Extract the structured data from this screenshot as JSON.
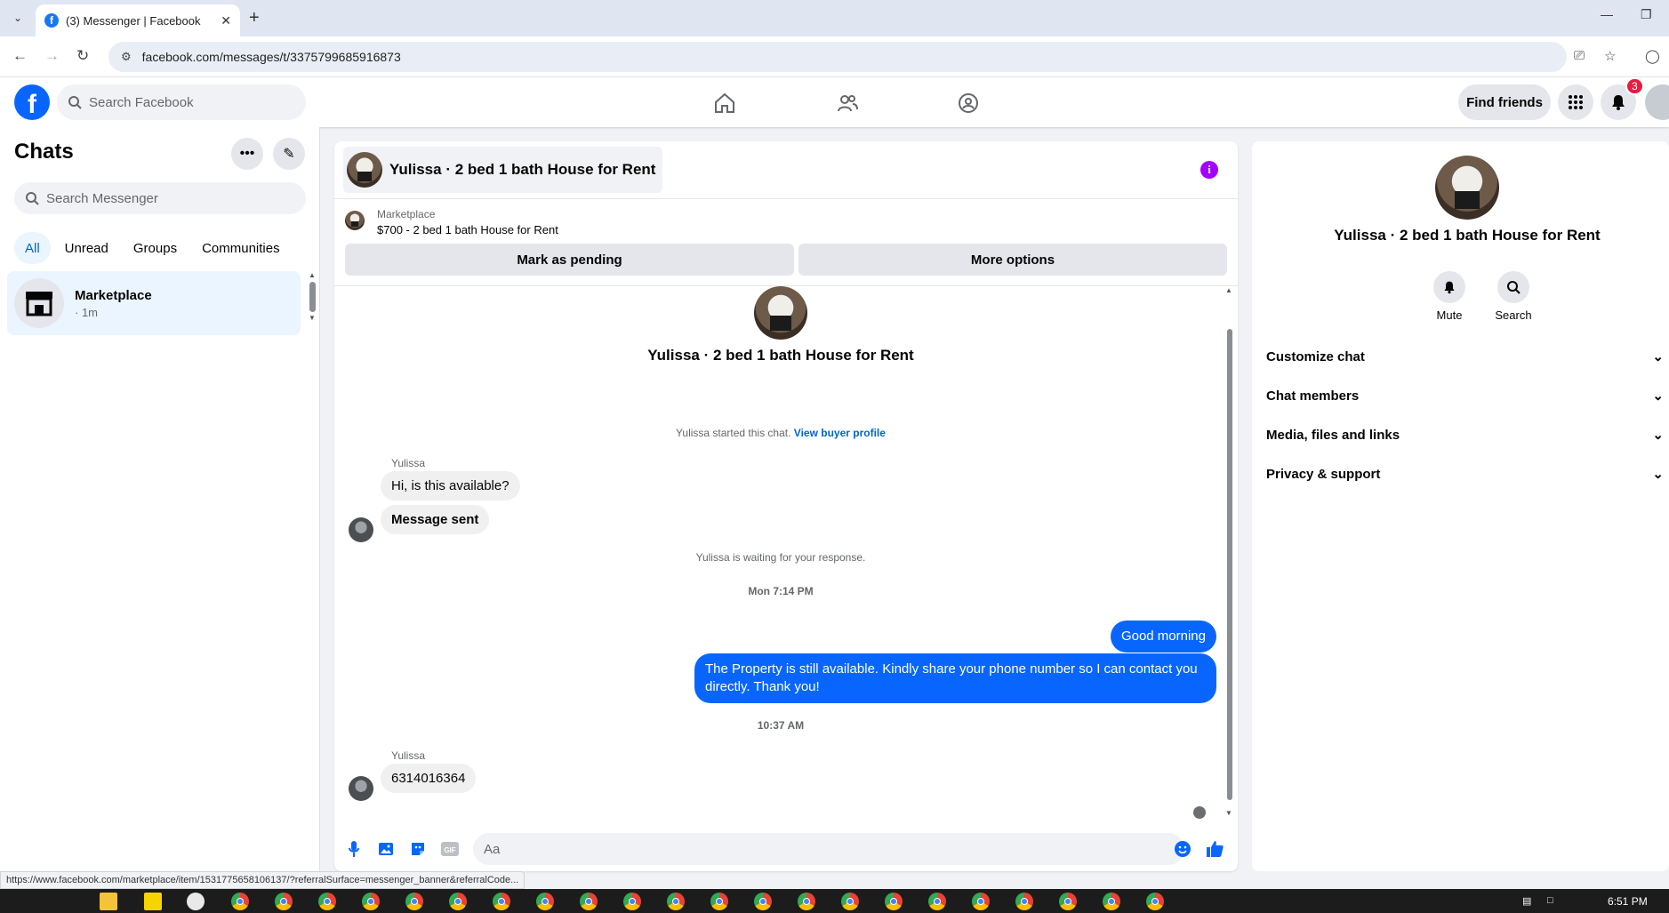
{
  "browser": {
    "tab_title": "(3) Messenger | Facebook",
    "url": "facebook.com/messages/t/3375799685916873",
    "new_tab_symbol": "+",
    "status_url": "https://www.facebook.com/marketplace/item/1531775658106137/?referralSurface=messenger_banner&referralCode..."
  },
  "topnav": {
    "search_placeholder": "Search Facebook",
    "find_friends_label": "Find friends",
    "notification_count": "3",
    "icons": [
      "home-icon",
      "friends-icon",
      "groups-icon",
      "menu-grid-icon",
      "bell-icon"
    ]
  },
  "chats": {
    "title": "Chats",
    "search_placeholder": "Search Messenger",
    "filters": [
      "All",
      "Unread",
      "Groups",
      "Communities"
    ],
    "active_filter": "All",
    "items": [
      {
        "name": "Marketplace",
        "time": "· 1m"
      }
    ]
  },
  "conversation": {
    "title": "Yulissa · 2 bed 1 bath House for Rent",
    "marketplace_label": "Marketplace",
    "listing": "$700 - 2 bed 1 bath House for Rent",
    "mark_pending_label": "Mark as pending",
    "more_options_label": "More options",
    "started_text": "Yulissa started this chat.",
    "view_buyer_profile": "View buyer profile",
    "waiting_text": "Yulissa is waiting for your response.",
    "messages": {
      "sender1": "Yulissa",
      "in1": "Hi, is this available?",
      "in2": "Message sent",
      "time1": "Mon 7:14 PM",
      "out1": "Good morning",
      "out2": "The Property is still available. Kindly share your phone number so I can contact you directly. Thank you!",
      "time2": "10:37 AM",
      "sender2": "Yulissa",
      "in3": "6314016364"
    },
    "composer_placeholder": "Aa",
    "accent_color": "#0866ff"
  },
  "info_panel": {
    "name": "Yulissa · 2 bed 1 bath House for Rent",
    "mute_label": "Mute",
    "search_label": "Search",
    "sections": [
      "Customize chat",
      "Chat members",
      "Media, files and links",
      "Privacy & support"
    ]
  },
  "taskbar": {
    "time": "6:51 PM"
  }
}
